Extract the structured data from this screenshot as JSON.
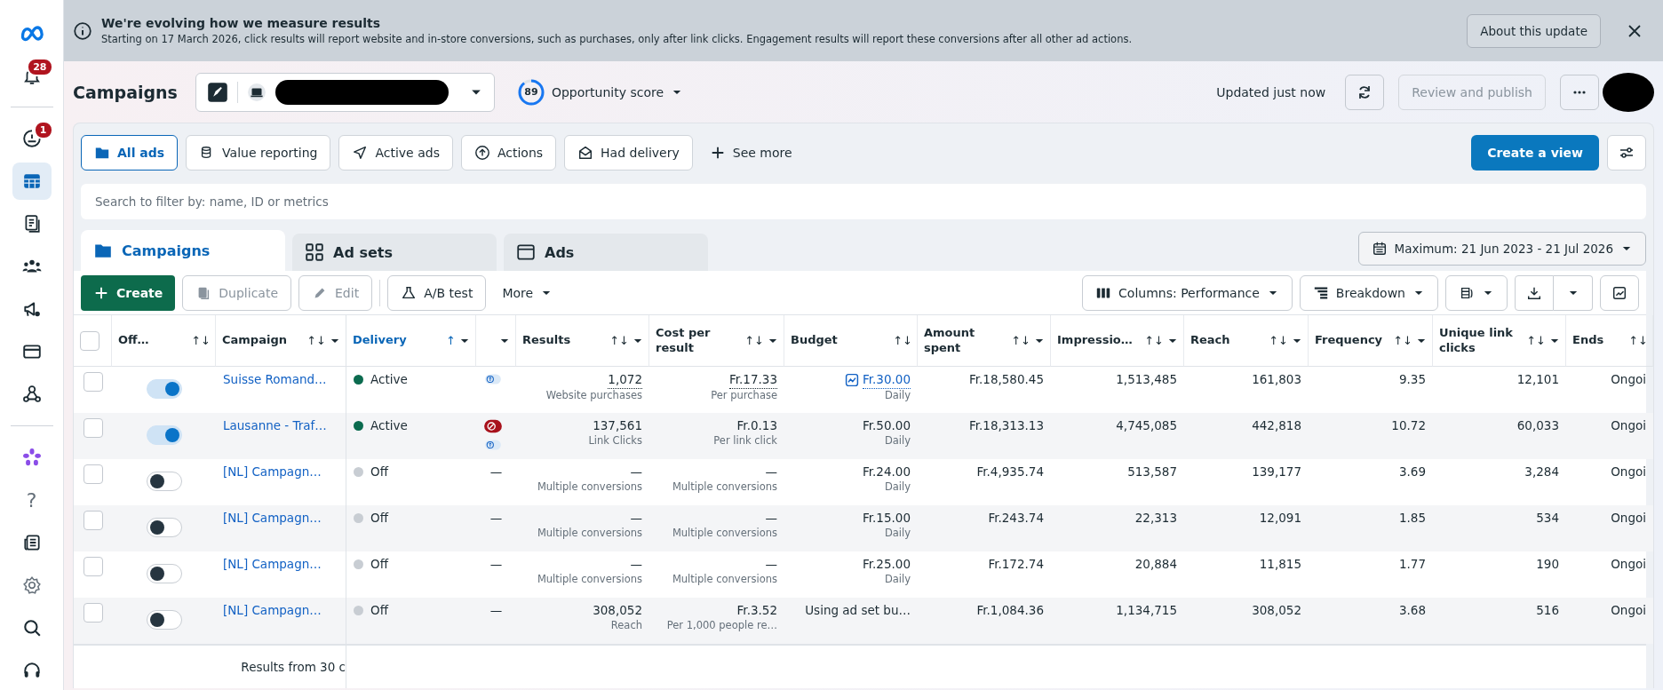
{
  "sidebar": {
    "items": [
      {
        "kind": "meta",
        "selected": false
      },
      {
        "kind": "bell",
        "selected": false,
        "badge": "28"
      },
      {
        "kind": "divider"
      },
      {
        "kind": "alert",
        "selected": false,
        "badge": "1"
      },
      {
        "kind": "table",
        "selected": true
      },
      {
        "kind": "docs",
        "selected": false
      },
      {
        "kind": "people",
        "selected": false
      },
      {
        "kind": "megaphone",
        "selected": false
      },
      {
        "kind": "card",
        "selected": false
      },
      {
        "kind": "network",
        "selected": false
      },
      {
        "kind": "divider"
      },
      {
        "kind": "flower",
        "selected": false
      },
      {
        "kind": "help",
        "selected": false,
        "text": "?"
      },
      {
        "kind": "news",
        "selected": false
      },
      {
        "kind": "gear",
        "selected": false
      },
      {
        "kind": "search",
        "selected": false
      },
      {
        "kind": "headset",
        "selected": false
      }
    ]
  },
  "banner": {
    "title": "We're evolving how we measure results",
    "text": "Starting on 17 March 2026, click results will report website and in-store conversions, such as purchases, only after link clicks. Engagement results will report these conversions after all other ad actions.",
    "button": "About this update"
  },
  "header": {
    "title": "Campaigns",
    "score": "89",
    "score_label": "Opportunity score",
    "updated": "Updated just now",
    "publish": {
      "label": "Review and publish",
      "disabled": true
    }
  },
  "filters": [
    {
      "label": "All ads",
      "selected": true
    },
    {
      "label": "Value reporting",
      "selected": false
    },
    {
      "label": "Active ads",
      "selected": false
    },
    {
      "label": "Actions",
      "selected": false
    },
    {
      "label": "Had delivery",
      "selected": false
    }
  ],
  "see_more": "See more",
  "create_view": "Create a view",
  "search": {
    "placeholder": "Search to filter by: name, ID or metrics"
  },
  "level_tabs": [
    {
      "label": "Campaigns",
      "selected": true
    },
    {
      "label": "Ad sets",
      "selected": false
    },
    {
      "label": "Ads",
      "selected": false
    }
  ],
  "date_range": "Maximum: 21 Jun 2023 - 21 Jul 2026",
  "toolbar": {
    "create": "Create",
    "duplicate": {
      "label": "Duplicate",
      "disabled": true
    },
    "edit": {
      "label": "Edit",
      "disabled": true
    },
    "ab_test": "A/B test",
    "more": "More",
    "columns": "Columns: Performance",
    "breakdown": "Breakdown"
  },
  "table": {
    "select_all_checked": false,
    "columns": [
      {
        "label": "Off…",
        "sort": "↑↓",
        "caret": false,
        "active": false
      },
      {
        "label": "Campaign",
        "sort": "↑↓",
        "caret": true,
        "active": false
      },
      {
        "label": "Delivery",
        "sort": "↑",
        "caret": true,
        "active": true
      },
      {
        "caret": true,
        "active": false
      },
      {
        "label": "Results",
        "sort": "↑↓",
        "caret": true,
        "active": false
      },
      {
        "label": "Cost per result",
        "sort": "↑↓",
        "caret": true,
        "active": false
      },
      {
        "label": "Budget",
        "sort": "↑↓",
        "caret": false,
        "active": false
      },
      {
        "label": "Amount spent",
        "sort": "↑↓",
        "caret": true,
        "active": false
      },
      {
        "label": "Impressio…",
        "sort": "↑↓",
        "caret": true,
        "active": false
      },
      {
        "label": "Reach",
        "sort": "↑↓",
        "caret": true,
        "active": false
      },
      {
        "label": "Frequency",
        "sort": "↑↓",
        "caret": true,
        "active": false
      },
      {
        "label": "Unique link clicks",
        "sort": "↑↓",
        "caret": true,
        "active": false
      },
      {
        "label": "Ends",
        "sort": "↑↓",
        "caret": false,
        "active": false
      }
    ],
    "rows": [
      {
        "checked": false,
        "on": true,
        "campaign": "Suisse Romand…",
        "delivery": {
          "label": "Active",
          "color": "#0b6b4f"
        },
        "column_4": {
          "kind": "icons",
          "error": false
        },
        "results": "1,072",
        "results_sub": "Website purchases",
        "cost": "Fr.17.33",
        "cost_sub": "Per purchase",
        "insights": true,
        "budget": "Fr.30.00",
        "budget_sub": "Daily",
        "amount": "Fr.18,580.45",
        "impressions": "1,513,485",
        "reach": "161,803",
        "frequency": "9.35",
        "unique": "12,101",
        "ends": "Ongoi"
      },
      {
        "checked": false,
        "on": true,
        "campaign": "Lausanne - Traf…",
        "delivery": {
          "label": "Active",
          "color": "#0b6b4f"
        },
        "column_4": {
          "kind": "icons",
          "error": true
        },
        "results": "137,561",
        "results_sub": "Link Clicks",
        "cost": "Fr.0.13",
        "cost_sub": "Per link click",
        "insights": false,
        "budget": "Fr.50.00",
        "budget_sub": "Daily",
        "amount": "Fr.18,313.13",
        "impressions": "4,745,085",
        "reach": "442,818",
        "frequency": "10.72",
        "unique": "60,033",
        "ends": "Ongoi"
      },
      {
        "checked": false,
        "on": false,
        "campaign": "[NL] Campagn…",
        "delivery": {
          "label": "Off",
          "color": "#c8cdd3"
        },
        "column_4": {
          "kind": "text",
          "text": "—"
        },
        "results": "—",
        "results_sub": "Multiple conversions",
        "cost": "—",
        "cost_sub": "Multiple conversions",
        "insights": false,
        "budget": "Fr.24.00",
        "budget_sub": "Daily",
        "amount": "Fr.4,935.74",
        "impressions": "513,587",
        "reach": "139,177",
        "frequency": "3.69",
        "unique": "3,284",
        "ends": "Ongoi"
      },
      {
        "checked": false,
        "on": false,
        "campaign": "[NL] Campagn…",
        "delivery": {
          "label": "Off",
          "color": "#c8cdd3"
        },
        "column_4": {
          "kind": "text",
          "text": "—"
        },
        "results": "—",
        "results_sub": "Multiple conversions",
        "cost": "—",
        "cost_sub": "Multiple conversions",
        "insights": false,
        "budget": "Fr.15.00",
        "budget_sub": "Daily",
        "amount": "Fr.243.74",
        "impressions": "22,313",
        "reach": "12,091",
        "frequency": "1.85",
        "unique": "534",
        "ends": "Ongoi"
      },
      {
        "checked": false,
        "on": false,
        "campaign": "[NL] Campagn…",
        "delivery": {
          "label": "Off",
          "color": "#c8cdd3"
        },
        "column_4": {
          "kind": "text",
          "text": "—"
        },
        "results": "—",
        "results_sub": "Multiple conversions",
        "cost": "—",
        "cost_sub": "Multiple conversions",
        "insights": false,
        "budget": "Fr.25.00",
        "budget_sub": "Daily",
        "amount": "Fr.172.74",
        "impressions": "20,884",
        "reach": "11,815",
        "frequency": "1.77",
        "unique": "190",
        "ends": "Ongoi"
      },
      {
        "checked": false,
        "on": false,
        "campaign": "[NL] Campagn…",
        "delivery": {
          "label": "Off",
          "color": "#c8cdd3"
        },
        "column_4": {
          "kind": "text",
          "text": "—"
        },
        "results": "308,052",
        "results_sub": "Reach",
        "cost": "Fr.3.52",
        "cost_sub": "Per 1,000 people re…",
        "insights": false,
        "budget": "Using ad set bu…",
        "amount": "Fr.1,084.36",
        "impressions": "1,134,715",
        "reach": "308,052",
        "frequency": "3.68",
        "unique": "516",
        "ends": "Ongoi"
      }
    ],
    "footer": "Results from 30 c"
  }
}
